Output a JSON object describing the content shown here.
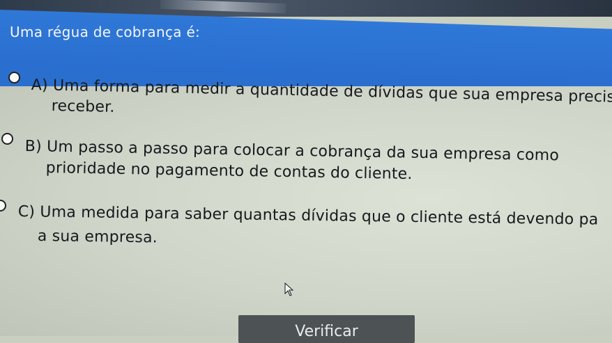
{
  "question": {
    "text": "Uma régua de cobrança é:"
  },
  "options": [
    {
      "letter": "A)",
      "line1": "Uma forma para medir a quantidade de dívidas que sua empresa precisa",
      "line2": "receber."
    },
    {
      "letter": "B)",
      "line1": "Um passo a passo para colocar a cobrança da sua empresa como",
      "line2": "prioridade no pagamento de contas do cliente."
    },
    {
      "letter": "C)",
      "line1": "Uma medida para saber quantas dívidas que o cliente está devendo pa",
      "line2": "a sua empresa."
    }
  ],
  "verify_button": {
    "label": "Verificar"
  },
  "colors": {
    "header_blue": "#2b6fcc",
    "background": "#cfd5c9",
    "button": "#4d5254"
  }
}
